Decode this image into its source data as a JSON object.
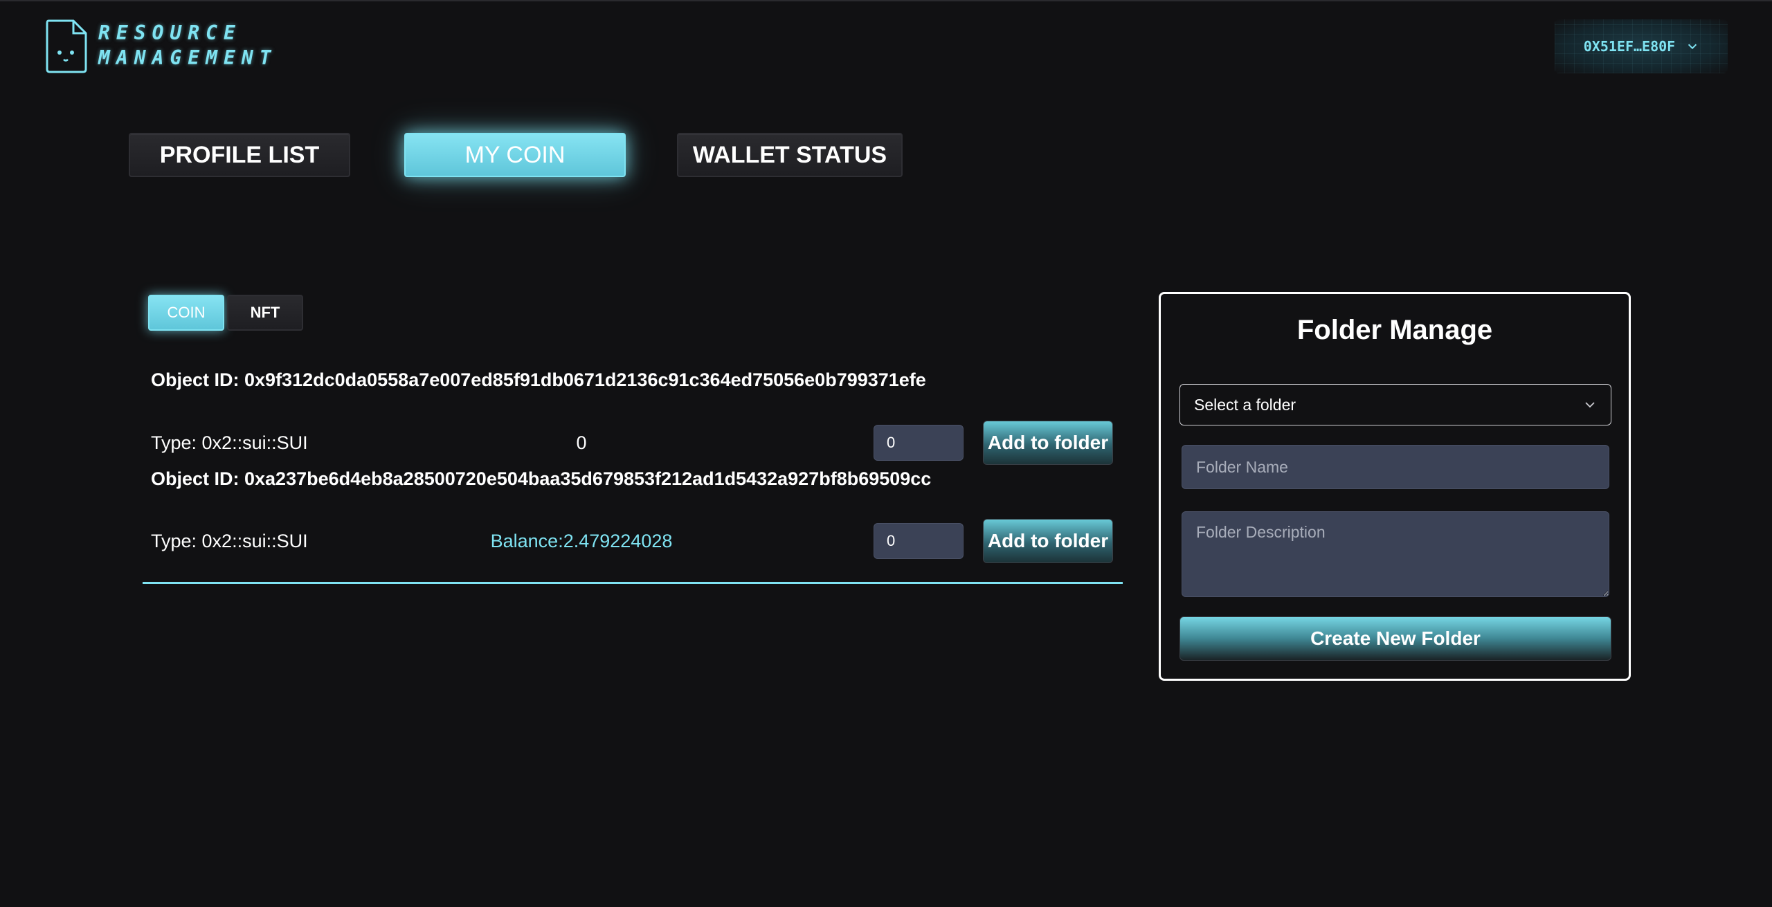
{
  "header": {
    "logo_line1": "RESOURCE",
    "logo_line2": "MANAGEMENT",
    "wallet_address": "0X51EF…E80F"
  },
  "main_tabs": [
    {
      "label": "PROFILE LIST",
      "active": false
    },
    {
      "label": "MY COIN",
      "active": true
    },
    {
      "label": "WALLET STATUS",
      "active": false
    }
  ],
  "sub_tabs": [
    {
      "label": "COIN",
      "active": true
    },
    {
      "label": "NFT",
      "active": false
    }
  ],
  "coins": [
    {
      "object_id": "Object ID: 0x9f312dc0da0558a7e007ed85f91db0671d2136c91c364ed75056e0b799371efe",
      "type": "Type: 0x2::sui::SUI",
      "balance": "0",
      "qty": "0",
      "button": "Add to folder"
    },
    {
      "object_id": "Object ID: 0xa237be6d4eb8a28500720e504baa35d679853f212ad1d5432a927bf8b69509cc",
      "type": "Type: 0x2::sui::SUI",
      "balance": "Balance:2.479224028",
      "qty": "0",
      "button": "Add to folder"
    }
  ],
  "folder_panel": {
    "title": "Folder Manage",
    "select_placeholder": "Select a folder",
    "name_placeholder": "Folder Name",
    "description_placeholder": "Folder Description",
    "create_button": "Create New Folder"
  },
  "colors": {
    "accent": "#7fe3f2",
    "background": "#111113",
    "input_bg": "#3b4256"
  }
}
